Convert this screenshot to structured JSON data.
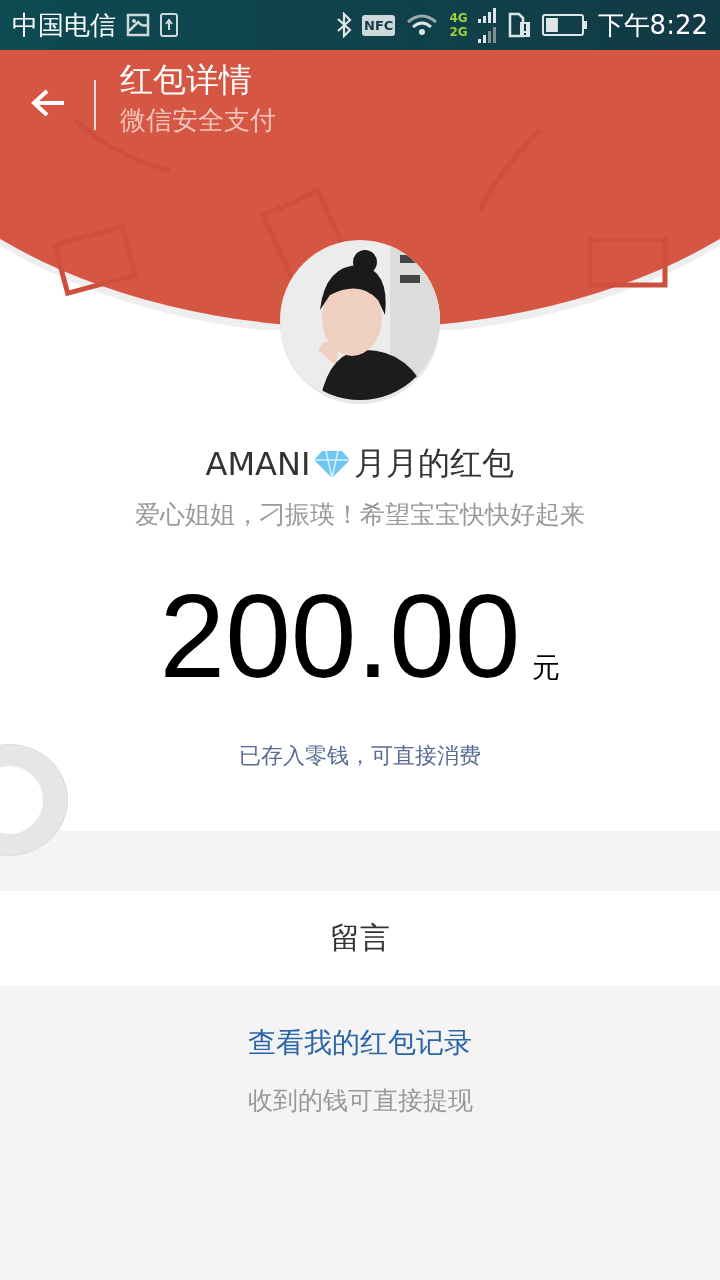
{
  "status_bar": {
    "carrier": "中国电信",
    "nfc": "NFC",
    "network_top": "4G",
    "network_bottom": "2G",
    "time": "下午8:22"
  },
  "header": {
    "title": "红包详情",
    "subtitle": "微信安全支付"
  },
  "sender": {
    "name_start": "AMANI",
    "name_end": "月月的红包",
    "wish": "爱心姐姐，刁振瑛！希望宝宝快快好起来"
  },
  "amount": {
    "value": "200.00",
    "unit": "元"
  },
  "note": "已存入零钱，可直接消费",
  "message_row": {
    "label": "留言"
  },
  "footer": {
    "link": "查看我的红包记录",
    "hint": "收到的钱可直接提现"
  }
}
